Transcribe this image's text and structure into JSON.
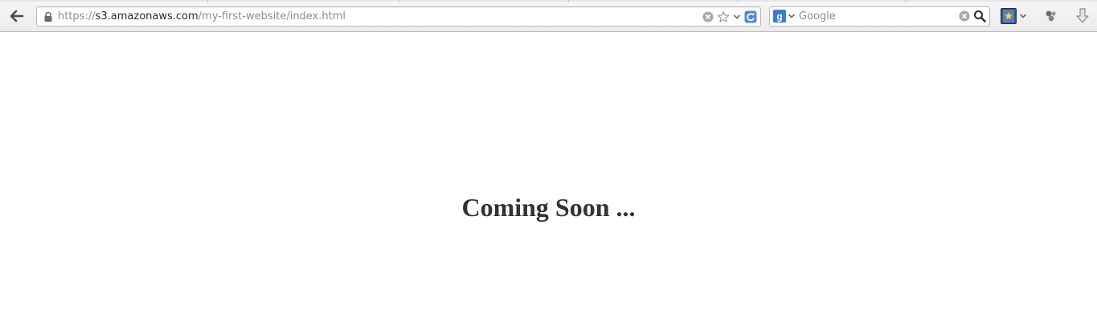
{
  "browser": {
    "url_scheme": "https://",
    "url_host": "s3.amazonaws.com",
    "url_path": "/my-first-website/index.html",
    "search_placeholder": "Google",
    "icons": {
      "back": "back-arrow-icon",
      "lock": "lock-icon",
      "clear_url": "clear-icon",
      "bookmark": "star-icon",
      "history_dropdown": "chevron-down-icon",
      "reload": "reload-icon",
      "search_engine": "google-icon",
      "clear_search": "clear-icon",
      "search": "magnifier-icon",
      "bookmarks_menu": "bookmarks-icon",
      "sync": "sync-icon",
      "downloads": "download-arrow-icon"
    },
    "colors": {
      "accent": "#3d7bd1",
      "toolbar": "#ececec"
    }
  },
  "page": {
    "heading": "Coming Soon ..."
  }
}
